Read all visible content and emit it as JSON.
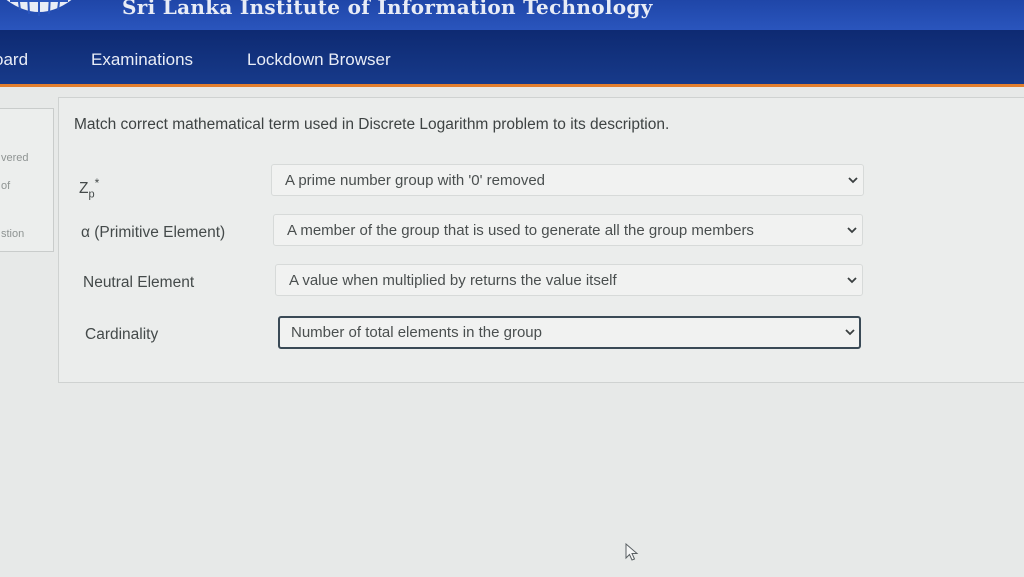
{
  "header": {
    "site_title": "Sri Lanka Institute of Information Technology"
  },
  "nav": {
    "dashboard": "oard",
    "examinations": "Examinations",
    "lockdown_browser": "Lockdown Browser"
  },
  "sidebar": {
    "line1": "vered",
    "line2": "of",
    "line3": "stion"
  },
  "question": {
    "text": "Match correct mathematical term used in Discrete Logarithm problem to its description.",
    "rows": [
      {
        "term_base": "Z",
        "term_sub": "p",
        "term_sup": "*",
        "answer": "A prime number group with '0' removed"
      },
      {
        "term": "α (Primitive Element)",
        "answer": "A member of the group that is used to generate all the group members"
      },
      {
        "term": "Neutral Element",
        "answer": "A value when multiplied by returns the value itself"
      },
      {
        "term": "Cardinality",
        "answer": "Number of total elements in the group"
      }
    ]
  },
  "colors": {
    "banner": "#2a55bd",
    "navbar": "#0e2a72",
    "nav_accent": "#e37f2e"
  },
  "icons": {
    "select_arrow": "chevron-down-icon",
    "pointer": "mouse-cursor-icon"
  }
}
